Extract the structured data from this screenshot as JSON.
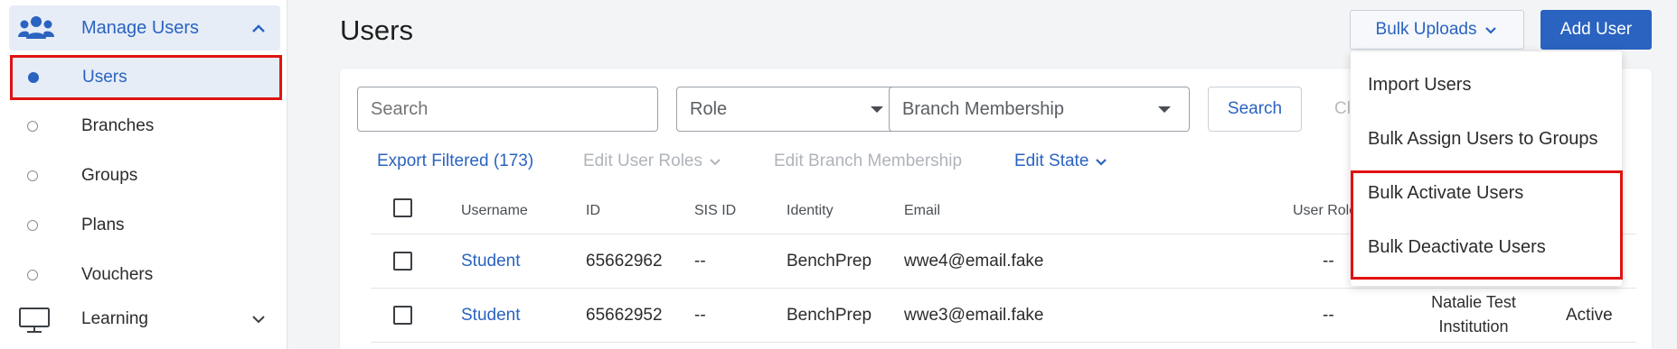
{
  "sidebar": {
    "group": {
      "label": "Manage Users",
      "icon": "users-icon"
    },
    "items": [
      {
        "label": "Users",
        "active": true
      },
      {
        "label": "Branches"
      },
      {
        "label": "Groups"
      },
      {
        "label": "Plans"
      },
      {
        "label": "Vouchers"
      }
    ],
    "learning": {
      "label": "Learning",
      "icon": "monitor-icon"
    }
  },
  "header": {
    "title": "Users",
    "bulk_label": "Bulk Uploads",
    "add_label": "Add User"
  },
  "filters": {
    "search_placeholder": "Search",
    "role_placeholder": "Role",
    "branch_placeholder": "Branch Membership",
    "search_button": "Search",
    "clear_button": "Cl"
  },
  "actions": {
    "export": "Export Filtered (173)",
    "edit_roles": "Edit User Roles",
    "edit_branch": "Edit Branch Membership",
    "edit_state": "Edit State"
  },
  "table": {
    "columns": [
      "Username",
      "ID",
      "SIS ID",
      "Identity",
      "Email",
      "User Role"
    ],
    "rows": [
      {
        "username": "Student",
        "id": "65662962",
        "sis_id": "--",
        "identity": "BenchPrep",
        "email": "wwe4@email.fake",
        "role": "--"
      },
      {
        "username": "Student",
        "id": "65662952",
        "sis_id": "--",
        "identity": "BenchPrep",
        "email": "wwe3@email.fake",
        "role": "--",
        "institution_line1": "Natalie Test",
        "institution_line2": "Institution",
        "state": "Active"
      }
    ]
  },
  "dropdown": {
    "items": [
      "Import Users",
      "Bulk Assign Users to Groups",
      "Bulk Activate Users",
      "Bulk Deactivate Users"
    ]
  },
  "colors": {
    "accent": "#2a63c0",
    "highlight": "#e01212",
    "sidebar_active_bg": "#e6edf7"
  }
}
